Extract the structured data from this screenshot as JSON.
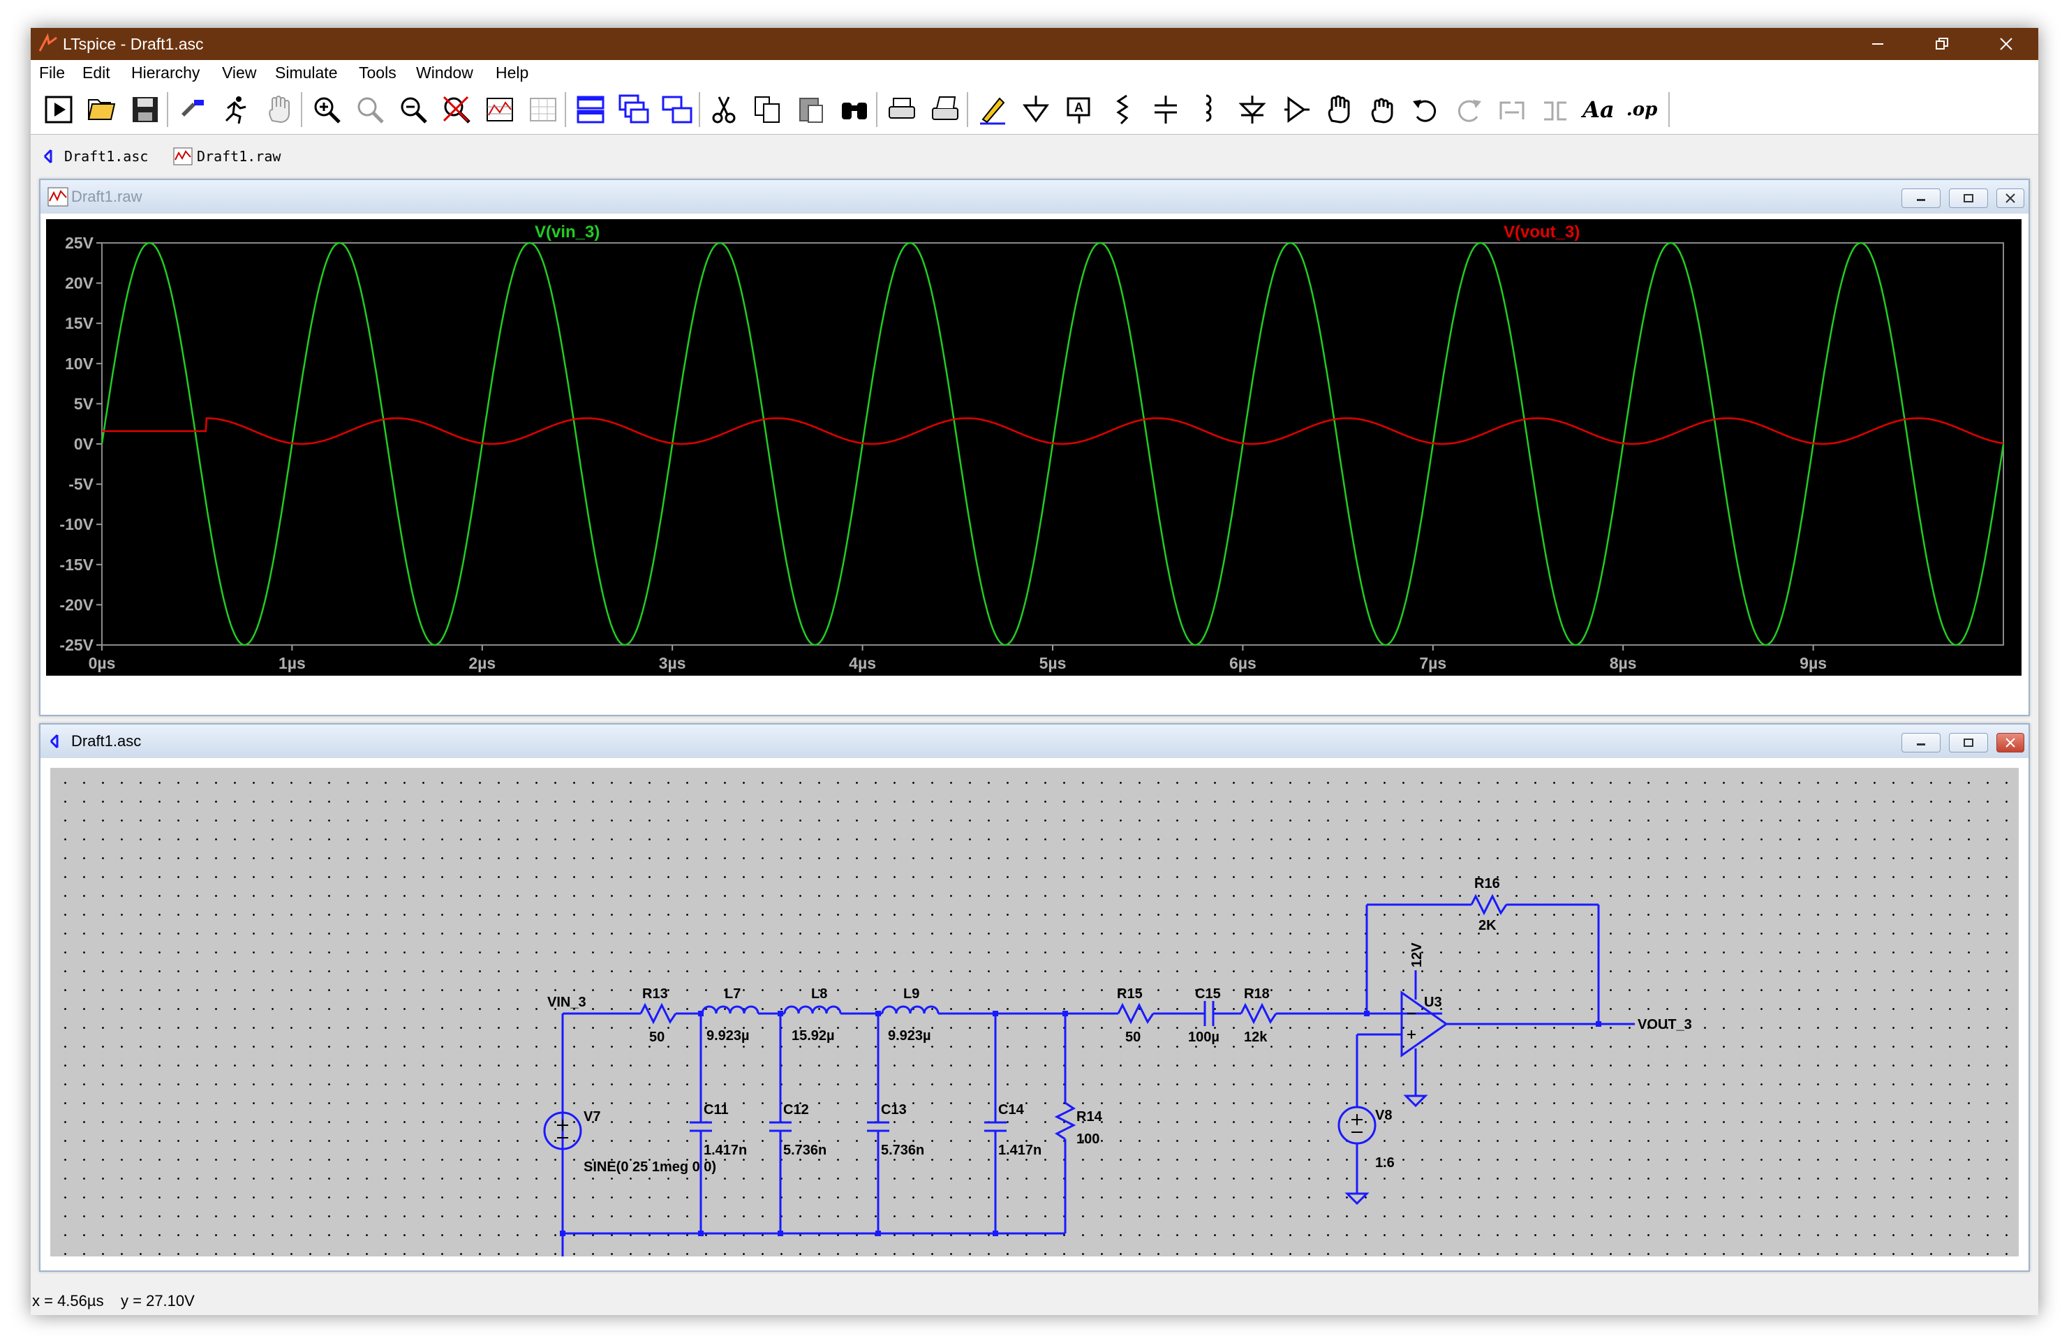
{
  "window": {
    "title": "LTspice - Draft1.asc"
  },
  "menu": [
    "File",
    "Edit",
    "Hierarchy",
    "View",
    "Simulate",
    "Tools",
    "Window",
    "Help"
  ],
  "toolbar": {
    "icons": [
      "run-icon",
      "open-icon",
      "save-icon",
      "control-panel-icon",
      "run-man-icon",
      "pan-hand-icon",
      "zoom-in-icon",
      "zoom-pan-icon",
      "zoom-out-icon",
      "zoom-fit-icon",
      "autorange-icon",
      "grid-icon",
      "tile-horizontal-icon",
      "cascade-icon",
      "tile-vertical-icon",
      "cut-icon",
      "copy-icon",
      "paste-icon",
      "find-icon",
      "print-icon",
      "print-setup-icon",
      "draw-wire-icon",
      "ground-icon",
      "label-net-icon",
      "resistor-icon",
      "capacitor-icon",
      "inductor-icon",
      "diode-icon",
      "component-icon",
      "move-icon",
      "drag-icon",
      "undo-icon",
      "redo-icon",
      "rotate-icon",
      "mirror-icon",
      "text-icon",
      "spice-directive-icon"
    ],
    "text_tool": "Aa",
    "op_tool": ".op"
  },
  "tabs": [
    {
      "label": "Draft1.asc"
    },
    {
      "label": "Draft1.raw"
    }
  ],
  "plot_window": {
    "title": "Draft1.raw"
  },
  "schematic_window": {
    "title": "Draft1.asc"
  },
  "chart_data": {
    "type": "line",
    "x_unit": "µs",
    "xlim": [
      0,
      10
    ],
    "ylim": [
      -25,
      25
    ],
    "x_ticks": [
      0,
      1,
      2,
      3,
      4,
      5,
      6,
      7,
      8,
      9
    ],
    "x_tick_labels": [
      "0µs",
      "1µs",
      "2µs",
      "3µs",
      "4µs",
      "5µs",
      "6µs",
      "7µs",
      "8µs",
      "9µs"
    ],
    "y_ticks": [
      25,
      20,
      15,
      10,
      5,
      0,
      -5,
      -10,
      -15,
      -20,
      -25
    ],
    "y_tick_labels": [
      "25V",
      "20V",
      "15V",
      "10V",
      "5V",
      "0V",
      "-5V",
      "-10V",
      "-15V",
      "-20V",
      "-25V"
    ],
    "series": [
      {
        "name": "V(vin_3)",
        "color": "#22cc22",
        "kind": "sine",
        "amplitude": 25,
        "offset": 0,
        "frequency_mhz": 1
      },
      {
        "name": "V(vout_3)",
        "color": "#e00000",
        "kind": "delayed-sine",
        "offset": 1.6,
        "amplitude": 1.6,
        "frequency_mhz": 1,
        "start_us": 0.55
      }
    ],
    "legend_placement": "top"
  },
  "schematic": {
    "wire_color": "#1a1aff",
    "labels": {
      "vin": "VIN_3",
      "vout": "VOUT_3",
      "r13": "R13",
      "r13_val": "50",
      "l7": "L7",
      "l7_val": "9.923µ",
      "l8": "L8",
      "l8_val": "15.92µ",
      "l9": "L9",
      "l9_val": "9.923µ",
      "c11": "C11",
      "c11_val": "1.417n",
      "c12": "C12",
      "c12_val": "5.736n",
      "c13": "C13",
      "c13_val": "5.736n",
      "c14": "C14",
      "c14_val": "1.417n",
      "r14": "R14",
      "r14_val": "100",
      "r15": "R15",
      "r15_val": "50",
      "c15": "C15",
      "c15_val": "100µ",
      "r18": "R18",
      "r18_val": "12k",
      "r16": "R16",
      "r16_val": "2K",
      "u3": "U3",
      "supply": "12V",
      "v7": "V7",
      "v7_val": "SINE(0 25 1meg 0 0)",
      "v8": "V8",
      "v8_val": "1.6"
    }
  },
  "status": {
    "text": "x = 4.56µs    y = 27.10V"
  }
}
